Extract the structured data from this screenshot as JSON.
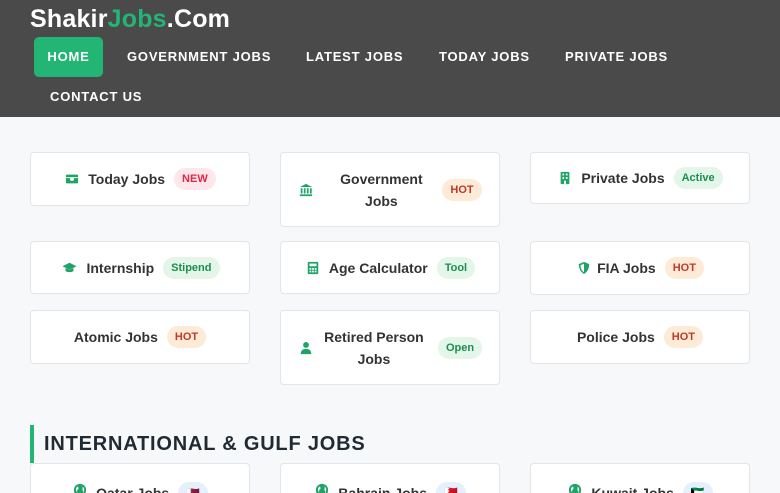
{
  "site": {
    "logo_main": "Shakir",
    "logo_accent": "Jobs",
    "logo_suffix": ".Com"
  },
  "nav": {
    "home": "HOME",
    "government": "GOVERNMENT JOBS",
    "latest": "LATEST JOBS",
    "today": "TODAY JOBS",
    "private": "PRIVATE JOBS",
    "contact": "CONTACT US"
  },
  "cards": [
    {
      "label": "Today Jobs",
      "badge": "NEW",
      "icon": "money-icon"
    },
    {
      "label": "Government Jobs",
      "badge": "HOT",
      "icon": "bank-icon"
    },
    {
      "label": "Private Jobs",
      "badge": "Active",
      "icon": "building-icon"
    },
    {
      "label": "Internship",
      "badge": "Stipend",
      "icon": "graduation-cap-icon"
    },
    {
      "label": "Age Calculator",
      "badge": "Tool",
      "icon": "calculator-icon"
    },
    {
      "label": "FIA Jobs",
      "badge": "HOT",
      "icon": "shield-icon"
    },
    {
      "label": "Atomic Jobs",
      "badge": "HOT",
      "icon": ""
    },
    {
      "label": "Retired Person Jobs",
      "badge": "Open",
      "icon": "user-icon"
    },
    {
      "label": "Police Jobs",
      "badge": "HOT",
      "icon": ""
    }
  ],
  "section": {
    "title": "INTERNATIONAL & GULF JOBS"
  },
  "gulf_cards": [
    {
      "label": "Qatar Jobs",
      "badge": "🇶🇦",
      "icon": "globe-icon"
    },
    {
      "label": "Bahrain Jobs",
      "badge": "🇧🇭",
      "icon": "globe-icon"
    },
    {
      "label": "Kuwait Jobs",
      "badge": "🇰🇼",
      "icon": "globe-icon"
    }
  ],
  "colors": {
    "accent": "#22b573",
    "header_bg": "#4a4a4a",
    "icon": "#1fa367"
  }
}
